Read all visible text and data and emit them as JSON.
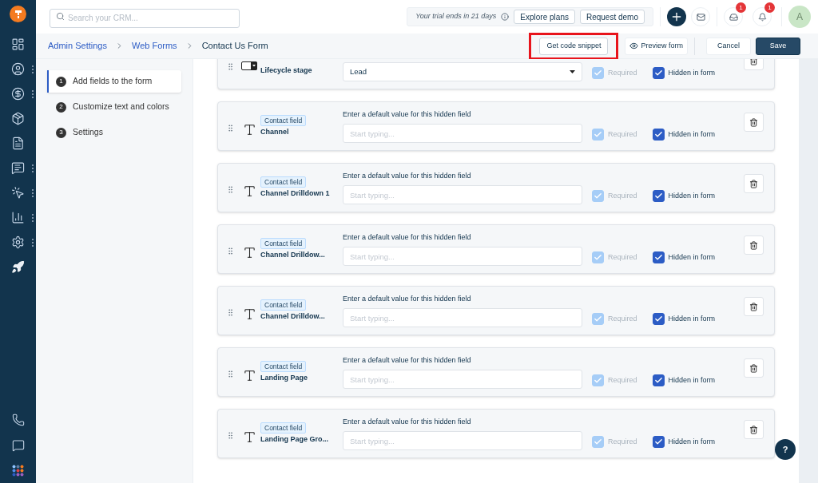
{
  "top_bar": {
    "search": {
      "placeholder": "Search your CRM..."
    },
    "trial_text": "Your trial ends in 21 days",
    "trial_buttons": [
      "Explore plans",
      "Request demo"
    ],
    "notification_badges": [
      "1",
      "1"
    ],
    "avatar": "A"
  },
  "breadcrumb": [
    {
      "label": "Admin Settings",
      "link": true
    },
    {
      "label": "Web Forms",
      "link": true
    },
    {
      "label": "Contact Us Form",
      "link": false
    }
  ],
  "actions": [
    {
      "label": "Get code snippet",
      "kind": "code",
      "highlighted": true
    },
    {
      "label": "Preview form",
      "kind": "preview",
      "highlighted": false
    },
    {
      "label": "Cancel",
      "kind": "secondary",
      "highlighted": false
    },
    {
      "label": "Save",
      "kind": "primary",
      "highlighted": false
    }
  ],
  "steps": [
    {
      "number": "1",
      "label": "Add fields to the form",
      "selected": true
    },
    {
      "number": "2",
      "label": "Customize text and colors",
      "selected": false
    },
    {
      "number": "3",
      "label": "Settings",
      "selected": false
    }
  ],
  "fields": [
    {
      "kind": "dropdown",
      "name": "Lifecycle stage",
      "value": "Lead",
      "required": {
        "label": "Required",
        "checked": true,
        "disabled": true
      },
      "hidden": {
        "label": "Hidden in form",
        "checked": true
      }
    },
    {
      "kind": "text",
      "tag": "Contact field",
      "name": "Channel",
      "prompt": "Enter a default value for this hidden field",
      "placeholder": "Start typing...",
      "required": {
        "label": "Required",
        "checked": true,
        "disabled": true
      },
      "hidden": {
        "label": "Hidden in form",
        "checked": true
      }
    },
    {
      "kind": "text",
      "tag": "Contact field",
      "name": "Channel Drilldown 1",
      "prompt": "Enter a default value for this hidden field",
      "placeholder": "Start typing...",
      "required": {
        "label": "Required",
        "checked": true,
        "disabled": true
      },
      "hidden": {
        "label": "Hidden in form",
        "checked": true
      }
    },
    {
      "kind": "text",
      "tag": "Contact field",
      "name": "Channel Drilldow...",
      "prompt": "Enter a default value for this hidden field",
      "placeholder": "Start typing...",
      "required": {
        "label": "Required",
        "checked": true,
        "disabled": true
      },
      "hidden": {
        "label": "Hidden in form",
        "checked": true
      }
    },
    {
      "kind": "text",
      "tag": "Contact field",
      "name": "Channel Drilldow...",
      "prompt": "Enter a default value for this hidden field",
      "placeholder": "Start typing...",
      "required": {
        "label": "Required",
        "checked": true,
        "disabled": true
      },
      "hidden": {
        "label": "Hidden in form",
        "checked": true
      }
    },
    {
      "kind": "text",
      "tag": "Contact field",
      "name": "Landing Page",
      "prompt": "Enter a default value for this hidden field",
      "placeholder": "Start typing...",
      "required": {
        "label": "Required",
        "checked": true,
        "disabled": true
      },
      "hidden": {
        "label": "Hidden in form",
        "checked": true
      }
    },
    {
      "kind": "text",
      "tag": "Contact field",
      "name": "Landing Page Gro...",
      "prompt": "Enter a default value for this hidden field",
      "placeholder": "Start typing...",
      "required": {
        "label": "Required",
        "checked": true,
        "disabled": true
      },
      "hidden": {
        "label": "Hidden in form",
        "checked": true
      }
    }
  ],
  "help_button": "?"
}
